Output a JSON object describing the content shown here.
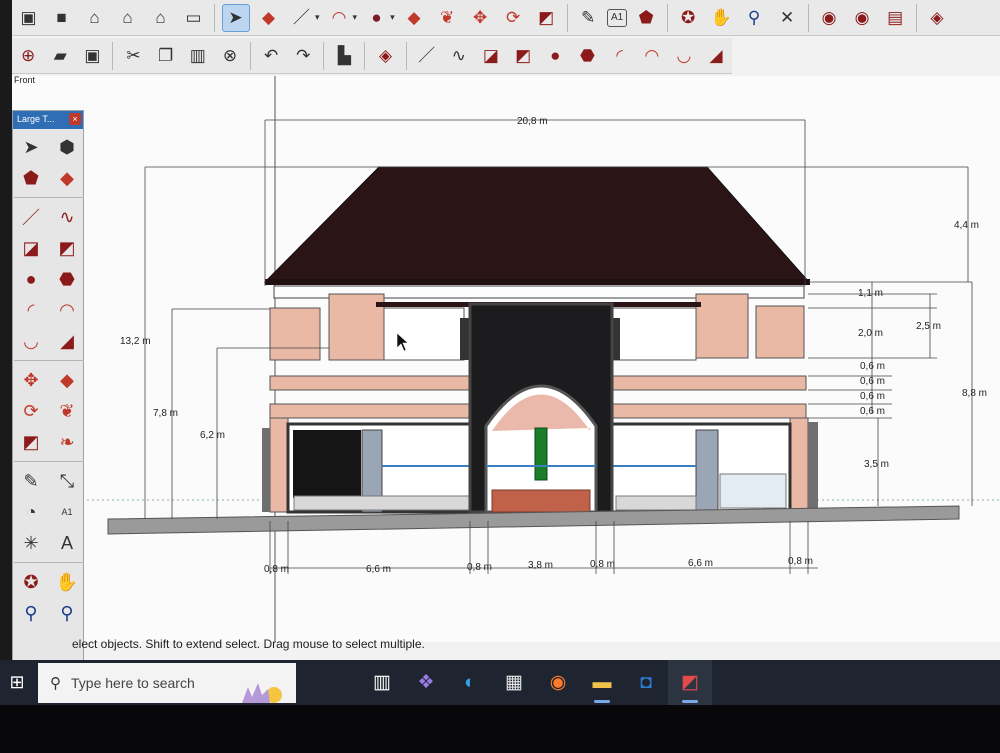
{
  "scene_tab": "Front",
  "palette": {
    "title": "Large T...",
    "close": "×",
    "tools": [
      "select-icon",
      "component-icon",
      "paint-bucket-icon",
      "eraser-icon",
      "line-icon",
      "freehand-icon",
      "rectangle-icon",
      "rotated-rectangle-icon",
      "circle-icon",
      "polygon-icon",
      "arc-icon",
      "two-point-arc-icon",
      "three-point-arc-icon",
      "pie-icon",
      "move-icon",
      "push-pull-icon",
      "rotate-icon",
      "follow-me-icon",
      "scale-icon",
      "offset-icon",
      "tape-measure-icon",
      "dimension-icon",
      "protractor-icon",
      "text-icon",
      "axes-icon",
      "3d-text-icon",
      "orbit-icon",
      "pan-icon",
      "zoom-icon",
      "zoom-extents-icon"
    ]
  },
  "toolbar1": [
    "box-icon",
    "cube-icon",
    "home-icon",
    "house-icon",
    "house-outline-icon",
    "folder-icon",
    "select-icon",
    "eraser-icon",
    "pencil-icon",
    "arc-icon",
    "circle-icon",
    "push-pull-icon",
    "follow-me-icon",
    "move-icon",
    "rotate-icon",
    "scale-icon",
    "tape-measure-icon",
    "text-icon",
    "paint-bucket-icon",
    "orbit-icon",
    "pan-icon",
    "zoom-icon",
    "zoom-extents-icon",
    "previous-view-icon",
    "next-view-icon",
    "warehouse-icon",
    "extension-icon"
  ],
  "toolbar2": [
    "new-icon",
    "open-icon",
    "save-icon",
    "cut-icon",
    "copy-icon",
    "paste-icon",
    "delete-icon",
    "undo-icon",
    "redo-icon",
    "print-icon",
    "model-info-icon",
    "line-icon",
    "freehand-icon",
    "rectangle-icon",
    "rotated-rectangle-icon",
    "circle-icon",
    "polygon-icon",
    "arc-icon",
    "two-point-arc-icon",
    "three-point-arc-icon",
    "pie-icon"
  ],
  "drawing": {
    "dimensions": {
      "top_width": "20,8 m",
      "roof_height": "4,4 m",
      "total_height": "13,2 m",
      "wall_height": "8,8 m",
      "height_7_8": "7,8 m",
      "height_6_2": "6,2 m",
      "d_1_1": "1,1 m",
      "d_2_0": "2,0 m",
      "d_2_5": "2,5 m",
      "d_0_6_a": "0,6 m",
      "d_0_6_b": "0,6 m",
      "d_0_6_c": "0,6 m",
      "d_0_6_d": "0,6 m",
      "d_3_5": "3,5 m",
      "b_0_8_a": "0,8 m",
      "b_6_6_a": "6,6 m",
      "b_0_8_b": "0,8 m",
      "b_3_8": "3,8 m",
      "b_0_8_c": "0,8 m",
      "b_6_6_b": "6,6 m",
      "b_0_8_d": "0,8 m"
    }
  },
  "status": "elect objects. Shift to extend select. Drag mouse to select multiple.",
  "taskbar": {
    "start": "windows-start-icon",
    "search_placeholder": "Type here to search",
    "apps": [
      "task-view-icon",
      "copilot-icon",
      "edge-icon",
      "store-icon",
      "firefox-icon",
      "file-explorer-icon",
      "outlook-icon",
      "sketchup-icon"
    ]
  }
}
